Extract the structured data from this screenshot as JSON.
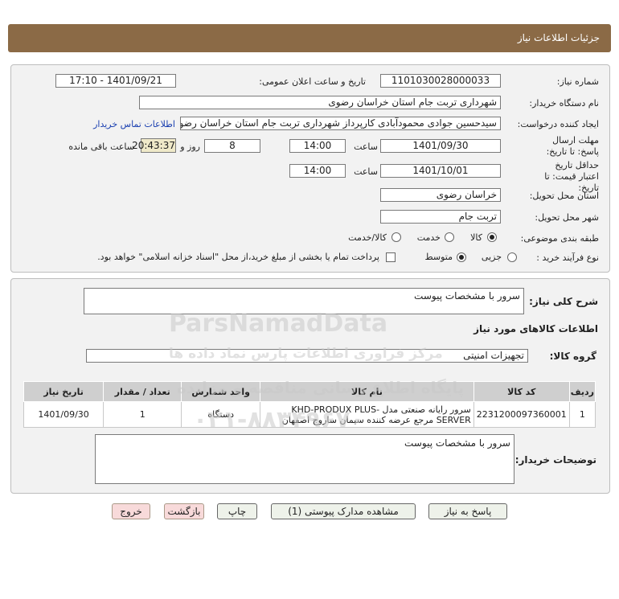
{
  "header": {
    "title": "جزئیات اطلاعات نیاز"
  },
  "form": {
    "need_number": {
      "label": "شماره نیاز:",
      "value": "1101030028000033"
    },
    "announce_datetime": {
      "label": "تاریخ و ساعت اعلان عمومی:",
      "value": "1401/09/21 - 17:10"
    },
    "buyer_org": {
      "label": "نام دستگاه خریدار:",
      "value": "شهرداری تربت جام استان خراسان رضوی"
    },
    "requester": {
      "label": "ایجاد کننده درخواست:",
      "value": "سیدحسین جوادی محمودآبادی کارپرداز شهرداری تربت جام استان خراسان رضو",
      "contact_link": "اطلاعات تماس خریدار"
    },
    "reply_deadline": {
      "label": "مهلت ارسال پاسخ: تا تاریخ:",
      "date": "1401/09/30",
      "time_label": "ساعت",
      "time": "14:00",
      "days": "8",
      "days_label": "روز و",
      "remaining": "20:43:37",
      "remaining_label": "ساعت باقی مانده"
    },
    "price_validity": {
      "label": "حداقل تاریخ اعتبار قیمت: تا تاریخ:",
      "date": "1401/10/01",
      "time_label": "ساعت",
      "time": "14:00"
    },
    "delivery_province": {
      "label": "استان محل تحویل:",
      "value": "خراسان رضوی"
    },
    "delivery_city": {
      "label": "شهر محل تحویل:",
      "value": "تربت جام"
    },
    "category": {
      "label": "طبقه بندی موضوعی:",
      "options": [
        "کالا",
        "خدمت",
        "کالا/خدمت"
      ],
      "selected": "کالا"
    },
    "process_type": {
      "label": "نوع فرآیند خرید :",
      "options": [
        "جزیی",
        "متوسط"
      ],
      "selected": "متوسط",
      "payment_note": "پرداخت تمام یا بخشی از مبلغ خرید،از محل \"اسناد خزانه اسلامی\" خواهد بود."
    }
  },
  "general_desc": {
    "label": "شرح کلی نیاز:",
    "value": "سرور با مشخصات پیوست"
  },
  "goods_info_title": "اطلاعات کالاهای مورد نیاز",
  "goods_group": {
    "label": "گروه کالا:",
    "value": "تجهیزات امنیتی"
  },
  "table": {
    "headers": [
      "ردیف",
      "کد کالا",
      "نام کالا",
      "واحد شمارش",
      "تعداد / مقدار",
      "تاریخ نیاز"
    ],
    "rows": [
      [
        "1",
        "2231200097360001",
        "سرور رایانه صنعتی مدل KHD-PRODUX PLUS-SERVER مرجع عرضه کننده سیمان ساروج اصفهان",
        "دستگاه",
        "1",
        "1401/09/30"
      ]
    ]
  },
  "buyer_notes": {
    "label": "توضیحات خریدار:",
    "value": "سرور با مشخصات پیوست"
  },
  "buttons": {
    "reply": "پاسخ به نیاز",
    "attachments": "مشاهده مدارک پیوستی (1)",
    "print": "چاپ",
    "back": "بازگشت",
    "exit": "خروج"
  },
  "watermark": {
    "number": "۰۲۱-۸۸۳۴۹۶۷۰",
    "brand": "ParsNamadData",
    "line1": "مرکز فراوری اطلاعات پارس نماد داده ها",
    "line2": "پایگاه اطلاع رسانی مناقصه و مزایده"
  }
}
